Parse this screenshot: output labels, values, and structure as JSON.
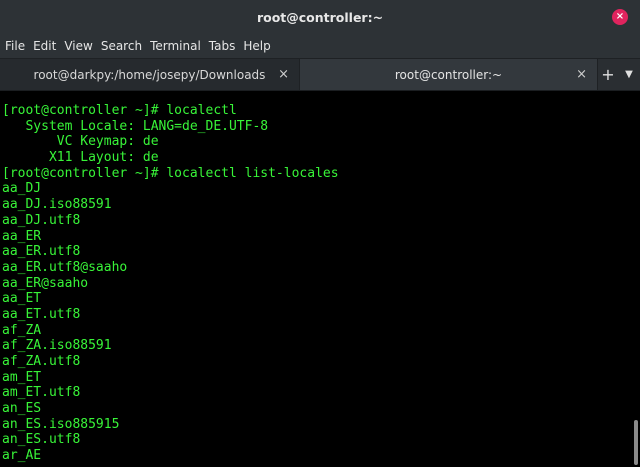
{
  "window": {
    "title": "root@controller:~",
    "close_glyph": "×"
  },
  "menu": [
    "File",
    "Edit",
    "View",
    "Search",
    "Terminal",
    "Tabs",
    "Help"
  ],
  "tabs": [
    {
      "label": "root@darkpy:/home/josepy/Downloads",
      "close_glyph": "×"
    },
    {
      "label": "root@controller:~",
      "close_glyph": "×"
    }
  ],
  "tab_controls": {
    "add_glyph": "+",
    "menu_glyph": "▼"
  },
  "terminal": {
    "color": "#38f438",
    "lines": [
      "[root@controller ~]# localectl",
      "   System Locale: LANG=de_DE.UTF-8",
      "       VC Keymap: de",
      "      X11 Layout: de",
      "[root@controller ~]# localectl list-locales",
      "aa_DJ",
      "aa_DJ.iso88591",
      "aa_DJ.utf8",
      "aa_ER",
      "aa_ER.utf8",
      "aa_ER.utf8@saaho",
      "aa_ER@saaho",
      "aa_ET",
      "aa_ET.utf8",
      "af_ZA",
      "af_ZA.iso88591",
      "af_ZA.utf8",
      "am_ET",
      "am_ET.utf8",
      "an_ES",
      "an_ES.iso885915",
      "an_ES.utf8",
      "ar_AE"
    ]
  }
}
